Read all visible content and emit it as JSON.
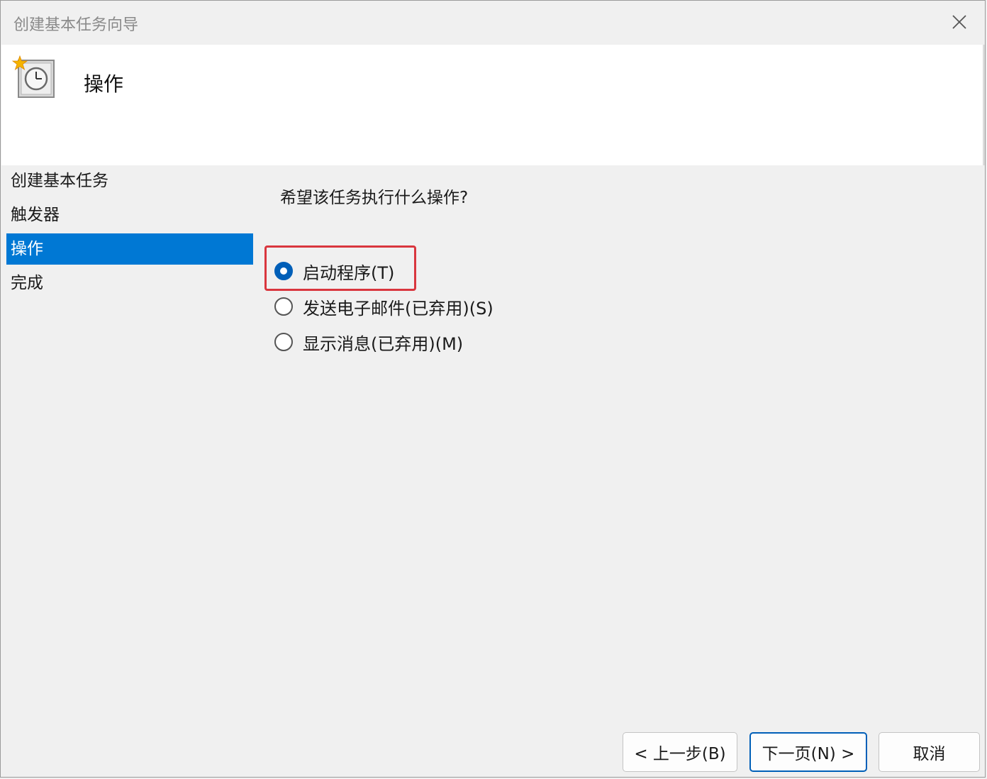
{
  "window": {
    "title": "创建基本任务向导"
  },
  "header": {
    "title": "操作",
    "icon": "task-scheduler-clock-icon"
  },
  "sidebar": {
    "items": [
      {
        "label": "创建基本任务",
        "active": false
      },
      {
        "label": "触发器",
        "active": false
      },
      {
        "label": "操作",
        "active": true
      },
      {
        "label": "完成",
        "active": false
      }
    ]
  },
  "main": {
    "question": "希望该任务执行什么操作?",
    "options": [
      {
        "label": "启动程序(T)",
        "checked": true
      },
      {
        "label": "发送电子邮件(已弃用)(S)",
        "checked": false
      },
      {
        "label": "显示消息(已弃用)(M)",
        "checked": false
      }
    ]
  },
  "buttons": {
    "back": "< 上一步(B)",
    "next": "下一页(N) >",
    "cancel": "取消"
  },
  "colors": {
    "accent": "#0078d4",
    "highlight": "#d9363e"
  }
}
